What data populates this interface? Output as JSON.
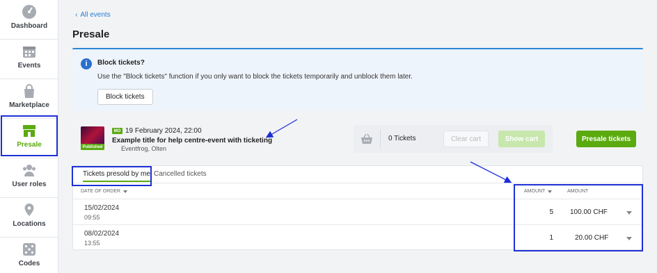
{
  "sidebar": {
    "items": [
      {
        "label": "Dashboard",
        "icon": "dashboard-icon"
      },
      {
        "label": "Events",
        "icon": "calendar-icon"
      },
      {
        "label": "Marketplace",
        "icon": "shopping-bag-icon"
      },
      {
        "label": "Presale",
        "icon": "store-icon"
      },
      {
        "label": "User roles",
        "icon": "users-icon"
      },
      {
        "label": "Locations",
        "icon": "location-pin-icon"
      },
      {
        "label": "Codes",
        "icon": "dice-icon"
      }
    ],
    "active_color": "#5aaa10"
  },
  "breadcrumb": {
    "back_label": "All events"
  },
  "page": {
    "title": "Presale"
  },
  "info": {
    "title": "Block tickets?",
    "text": "Use the \"Block tickets\" function if you only want to block the tickets temporarily and unblock them later.",
    "button_label": "Block tickets"
  },
  "event": {
    "badge": "Published",
    "day": "MO",
    "date": "19 February 2024, 22:00",
    "title": "Example title for help centre-event with ticketing",
    "venue": "Eventfrog, Olten"
  },
  "cart": {
    "count_label": "0 Tickets",
    "clear_label": "Clear cart",
    "show_label": "Show cart"
  },
  "presale_button": "Presale tickets",
  "tabs": [
    {
      "label": "Tickets presold by me",
      "active": true
    },
    {
      "label": "Cancelled tickets",
      "active": false
    }
  ],
  "table": {
    "columns": {
      "date": "DATE OF ORDER",
      "amount_qty": "AMOUNT",
      "amount_price": "AMOUNT"
    },
    "rows": [
      {
        "date": "15/02/2024",
        "time": "09:55",
        "qty": "5",
        "price": "100.00 CHF"
      },
      {
        "date": "08/02/2024",
        "time": "13:55",
        "qty": "1",
        "price": "20.00 CHF"
      }
    ]
  },
  "colors": {
    "accent_green": "#5aaa10",
    "link_blue": "#2a7bd0",
    "annotation_blue": "#1d2fd6"
  }
}
